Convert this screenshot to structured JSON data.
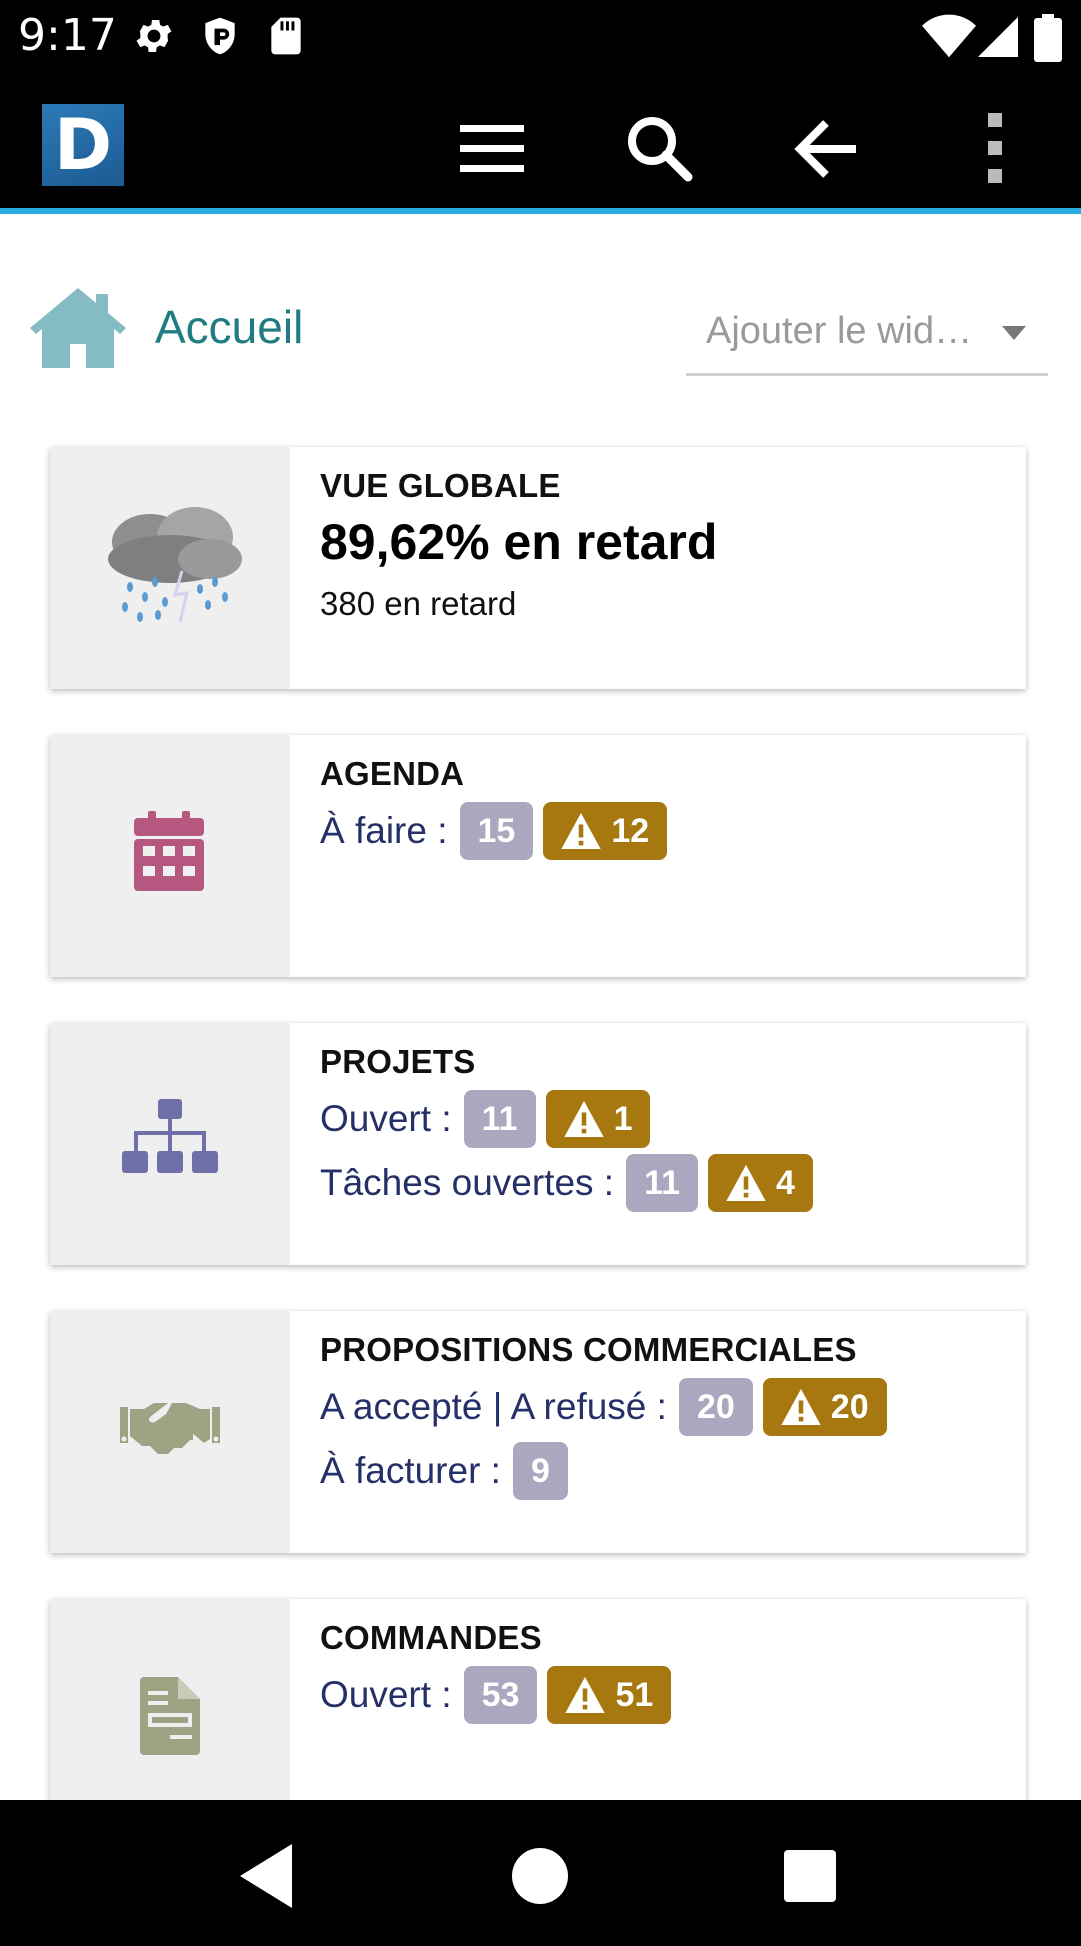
{
  "status_bar": {
    "time": "9:17",
    "icons": [
      "gear-icon",
      "shield-icon",
      "sd-card-icon",
      "wifi-icon",
      "signal-icon",
      "battery-icon"
    ]
  },
  "app_bar": {
    "logo_letter": "D",
    "accent": "#29aee3",
    "buttons": [
      "menu-icon",
      "search-icon",
      "back-arrow-icon",
      "more-vert-icon"
    ]
  },
  "header": {
    "title": "Accueil",
    "widget_select": "Ajouter le wid…"
  },
  "cards": {
    "global": {
      "title": "VUE GLOBALE",
      "percent": "89,62% en retard",
      "count": "380 en retard",
      "icon": "storm-cloud-icon"
    },
    "agenda": {
      "title": "AGENDA",
      "icon": "calendar-icon",
      "rows": [
        {
          "label": "À faire :",
          "count": "15",
          "late": "12"
        }
      ]
    },
    "projets": {
      "title": "PROJETS",
      "icon": "org-chart-icon",
      "rows": [
        {
          "label": "Ouvert :",
          "count": "11",
          "late": "1"
        },
        {
          "label": "Tâches ouvertes :",
          "count": "11",
          "late": "4"
        }
      ]
    },
    "propositions": {
      "title": "PROPOSITIONS COMMERCIALES",
      "icon": "handshake-icon",
      "rows": [
        {
          "label": "A accepté | A refusé :",
          "count": "20",
          "late": "20"
        },
        {
          "label": "À facturer :",
          "count": "9"
        }
      ]
    },
    "commandes": {
      "title": "COMMANDES",
      "icon": "document-icon",
      "rows": [
        {
          "label": "Ouvert :",
          "count": "53",
          "late": "51"
        }
      ]
    }
  },
  "colors": {
    "title_teal": "#1f7c83",
    "label_navy": "#263068",
    "badge_grey": "#a9a8be",
    "badge_warn": "#a6780f",
    "calendar": "#b5577e",
    "org_chart": "#6f70a8",
    "handshake": "#9ea383"
  },
  "nav_bar": {
    "buttons": [
      "nav-back-icon",
      "nav-home-icon",
      "nav-recents-icon"
    ]
  }
}
